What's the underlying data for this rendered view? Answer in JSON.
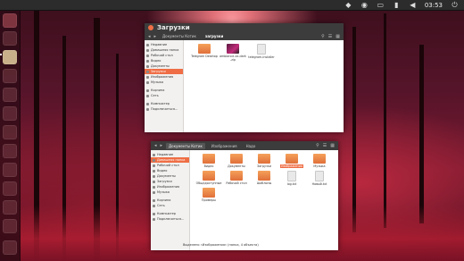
{
  "top_panel": {
    "clock": "03:53",
    "icons": [
      "dropbox-icon",
      "network-icon",
      "keyboard-icon",
      "battery-icon",
      "volume-icon",
      "power-icon"
    ]
  },
  "launcher": {
    "items": [
      "dash-icon",
      "files-icon",
      "app-icon-1",
      "app-icon-2",
      "app-icon-3",
      "app-icon-4",
      "app-icon-5",
      "app-icon-6",
      "app-icon-7",
      "app-icon-8",
      "app-icon-9",
      "app-icon-10",
      "trash-icon"
    ]
  },
  "window1": {
    "title": "Загрузки",
    "breadcrumbs": [
      "◂",
      "▸",
      "Документы Котик",
      "загрузки"
    ],
    "sidebar": [
      {
        "label": "Недавние"
      },
      {
        "label": "Домашняя папка"
      },
      {
        "label": "Рабочий стол"
      },
      {
        "label": "Видео"
      },
      {
        "label": "Документы"
      },
      {
        "label": "Загрузки",
        "selected": true
      },
      {
        "label": "Изображения"
      },
      {
        "label": "Музыка"
      },
      {
        "label": "Корзина"
      },
      {
        "label": "Сеть"
      },
      {
        "label": "Компьютер"
      },
      {
        "label": "Подключиться..."
      }
    ],
    "files": [
      {
        "name": "Telegram Desktop",
        "type": "folder"
      },
      {
        "name": "ambiance-xx-dark-zip",
        "type": "img"
      },
      {
        "name": "telegram-installer",
        "type": "doc"
      }
    ]
  },
  "window2": {
    "breadcrumbs": [
      "◂",
      "▸",
      "Документы Котик",
      "Изображения",
      "Надо"
    ],
    "sidebar": [
      {
        "label": "Недавние"
      },
      {
        "label": "Домашняя папка",
        "selected": true
      },
      {
        "label": "Рабочий стол"
      },
      {
        "label": "Видео"
      },
      {
        "label": "Документы"
      },
      {
        "label": "Загрузки"
      },
      {
        "label": "Изображения"
      },
      {
        "label": "Музыка"
      },
      {
        "label": "Корзина"
      },
      {
        "label": "Сеть"
      },
      {
        "label": "Компьютер"
      },
      {
        "label": "Подключиться..."
      }
    ],
    "files_row1": [
      {
        "name": "Видео",
        "type": "folder"
      },
      {
        "name": "Документы",
        "type": "folder"
      },
      {
        "name": "Загрузки",
        "type": "folder"
      },
      {
        "name": "Изображения",
        "type": "folder",
        "selected": true
      },
      {
        "name": "Музыка",
        "type": "folder"
      }
    ],
    "files_row2": [
      {
        "name": "Общедоступные",
        "type": "folder"
      },
      {
        "name": "Рабочий стол",
        "type": "folder"
      },
      {
        "name": "Шаблоны",
        "type": "folder"
      },
      {
        "name": "log.txt",
        "type": "doc"
      },
      {
        "name": "Новый.txt",
        "type": "doc"
      }
    ],
    "files_row3": [
      {
        "name": "Примеры",
        "type": "folder"
      }
    ],
    "status": "Выделено «Изображения» (папка, 4 объекта)"
  }
}
